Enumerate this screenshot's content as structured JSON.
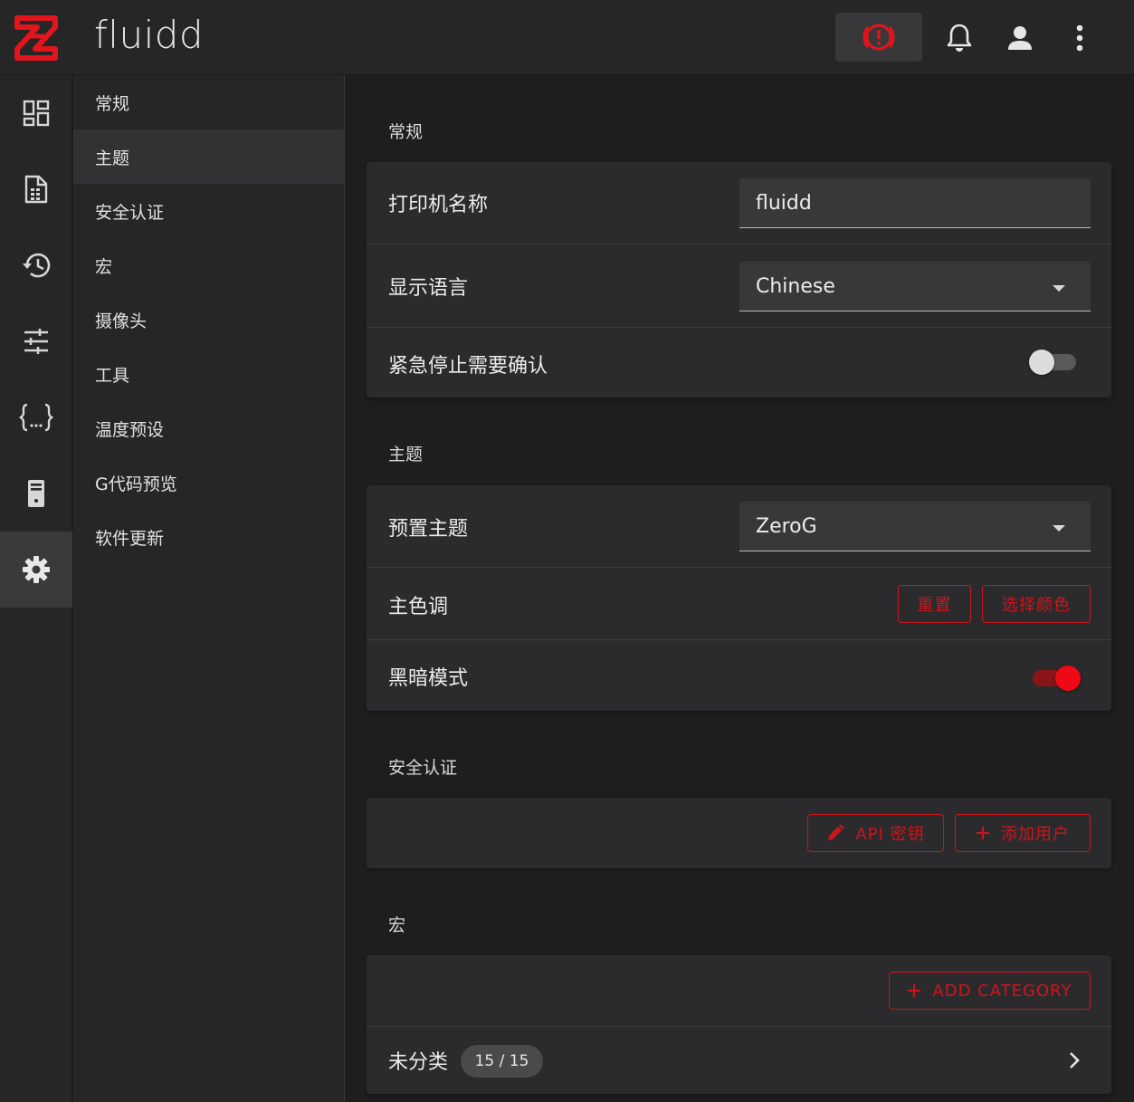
{
  "app": {
    "title": "fluidd"
  },
  "colors": {
    "accent": "#d0141c",
    "background": "#1e1e1f",
    "surface": "#2b2b2d"
  },
  "topbar": {
    "estop_icon": "emergency-stop-icon",
    "notifications_icon": "bell-icon",
    "user_icon": "account-icon",
    "menu_icon": "dots-vertical-icon"
  },
  "rail": {
    "items": [
      {
        "icon": "dashboard-icon"
      },
      {
        "icon": "file-document-icon"
      },
      {
        "icon": "history-icon"
      },
      {
        "icon": "tune-icon"
      },
      {
        "icon": "code-braces-icon"
      },
      {
        "icon": "server-icon"
      },
      {
        "icon": "gear-icon",
        "active": true
      }
    ]
  },
  "menu": {
    "items": [
      {
        "label": "常规"
      },
      {
        "label": "主题",
        "active": true
      },
      {
        "label": "安全认证"
      },
      {
        "label": "宏"
      },
      {
        "label": "摄像头"
      },
      {
        "label": "工具"
      },
      {
        "label": "温度预设"
      },
      {
        "label": "G代码预览"
      },
      {
        "label": "软件更新"
      }
    ]
  },
  "general": {
    "title": "常规",
    "printer_name_label": "打印机名称",
    "printer_name_value": "fluidd",
    "language_label": "显示语言",
    "language_value": "Chinese",
    "estop_confirm_label": "紧急停止需要确认",
    "estop_confirm_on": false
  },
  "theme": {
    "title": "主题",
    "preset_label": "预置主题",
    "preset_value": "ZeroG",
    "primary_color_label": "主色调",
    "reset_label": "重置",
    "pick_color_label": "选择颜色",
    "dark_mode_label": "黑暗模式",
    "dark_mode_on": true
  },
  "auth": {
    "title": "安全认证",
    "api_key_label": "API 密钥",
    "add_user_label": "添加用户"
  },
  "macros": {
    "title": "宏",
    "add_category_label": "ADD CATEGORY",
    "uncategorized_label": "未分类",
    "uncategorized_count": "15 / 15"
  }
}
